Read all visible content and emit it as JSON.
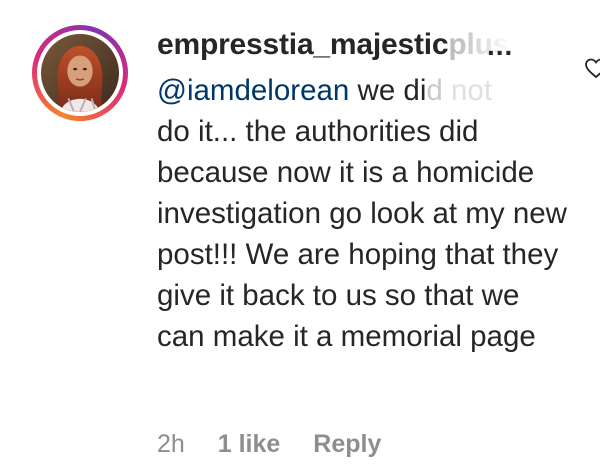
{
  "comment": {
    "username": "empresstia_majesticplus",
    "username_visible": "empresstia_majestic",
    "username_faded": "plus",
    "more_indicator": "...",
    "mention": "@iamdelorean",
    "text_first_line_rest": " we di",
    "text_faded_a": "d",
    "text_faded_b": " not",
    "text_rest": "do it... the authorities did because now it is a homicide investigation go look at my new post!!! We are hoping that they give it back to us so that we can make it a memorial page",
    "time": "2h",
    "likes": "1 like",
    "reply_label": "Reply"
  },
  "icons": {
    "avatar": "avatar-photo",
    "like": "heart-icon"
  },
  "colors": {
    "text": "#262626",
    "mention": "#00376b",
    "meta": "#8e8e8e",
    "ring_start": "#f58529",
    "ring_mid": "#dd2a7b",
    "ring_end": "#8134af"
  }
}
